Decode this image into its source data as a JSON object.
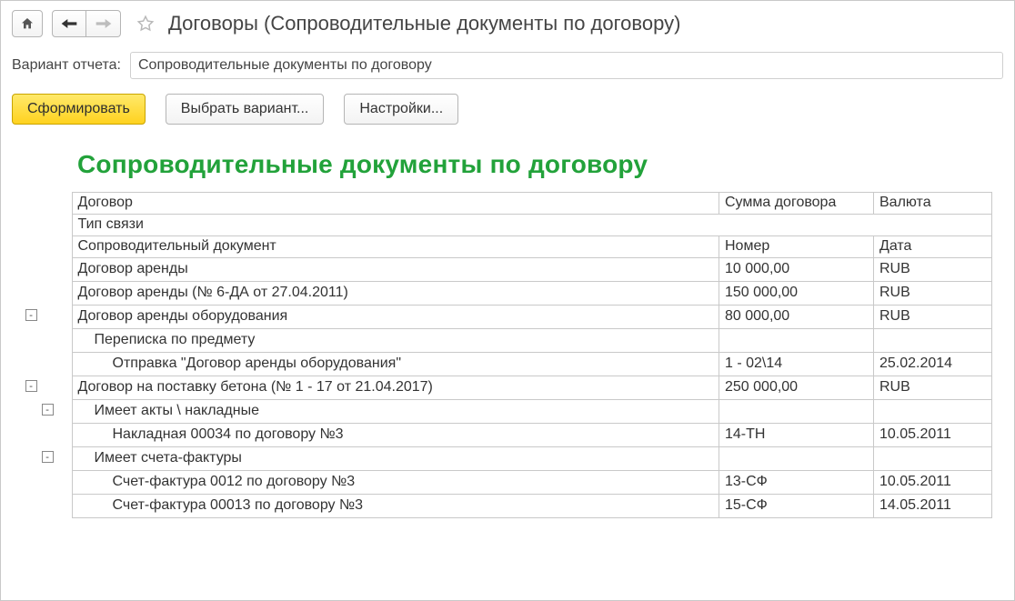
{
  "header": {
    "title": "Договоры (Сопроводительные документы по договору)"
  },
  "variant": {
    "label": "Вариант отчета:",
    "value": "Сопроводительные документы по договору"
  },
  "buttons": {
    "generate": "Сформировать",
    "choose_variant": "Выбрать вариант...",
    "settings": "Настройки..."
  },
  "report": {
    "title": "Сопроводительные документы по договору",
    "columns": {
      "contract": "Договор",
      "sum": "Сумма договора",
      "currency": "Валюта",
      "link_type": "Тип связи",
      "doc": "Сопроводительный документ",
      "number": "Номер",
      "date": "Дата"
    },
    "rows": [
      {
        "lvl": 0,
        "name": "Договор аренды",
        "mid": "10 000,00",
        "right": "RUB",
        "mid_align": "num",
        "toggle": null
      },
      {
        "lvl": 0,
        "name": "Договор аренды (№ 6-ДА от 27.04.2011)",
        "mid": "150 000,00",
        "right": "RUB",
        "mid_align": "num",
        "toggle": null
      },
      {
        "lvl": 0,
        "name": "Договор аренды оборудования",
        "mid": "80 000,00",
        "right": "RUB",
        "mid_align": "num",
        "toggle": "-",
        "toggle_col": 0
      },
      {
        "lvl": 1,
        "name": "Переписка по предмету",
        "mid": "",
        "right": "",
        "toggle": null
      },
      {
        "lvl": 2,
        "name": "Отправка \"Договор аренды оборудования\"",
        "mid": "1 - 02\\14",
        "right": "25.02.2014",
        "toggle": null
      },
      {
        "lvl": 0,
        "name": "Договор на поставку бетона (№ 1 - 17 от 21.04.2017)",
        "mid": "250 000,00",
        "right": "RUB",
        "mid_align": "num",
        "toggle": "-",
        "toggle_col": 0
      },
      {
        "lvl": 1,
        "name": "Имеет акты \\ накладные",
        "mid": "",
        "right": "",
        "toggle": "-",
        "toggle_col": 1
      },
      {
        "lvl": 2,
        "name": "Накладная 00034 по договору №3",
        "mid": "14-ТН",
        "right": "10.05.2011",
        "toggle": null
      },
      {
        "lvl": 1,
        "name": "Имеет счета-фактуры",
        "mid": "",
        "right": "",
        "toggle": "-",
        "toggle_col": 1
      },
      {
        "lvl": 2,
        "name": "Счет-фактура 0012 по договору №3",
        "mid": "13-СФ",
        "right": "10.05.2011",
        "toggle": null
      },
      {
        "lvl": 2,
        "name": "Счет-фактура 00013 по договору №3",
        "mid": "15-СФ",
        "right": "14.05.2011",
        "toggle": null
      }
    ]
  }
}
